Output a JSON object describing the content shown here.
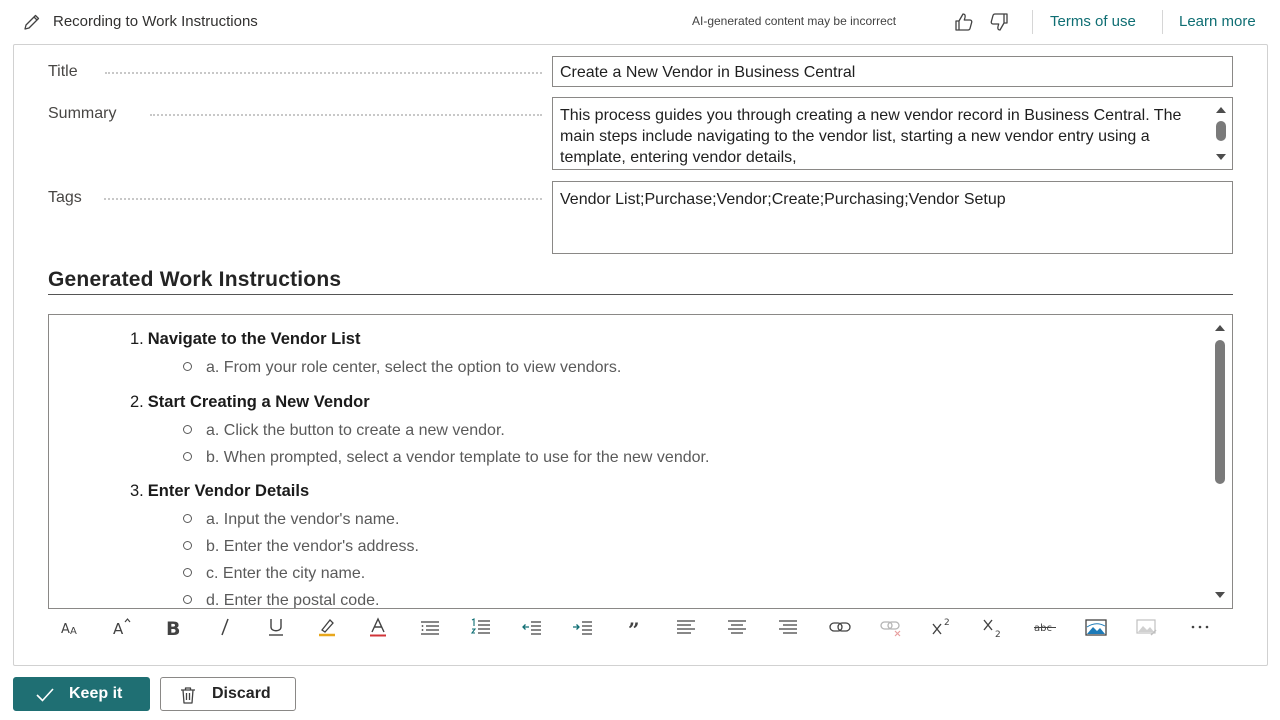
{
  "header": {
    "title": "Recording to Work Instructions",
    "disclaimer": "AI-generated content may be incorrect",
    "terms_link": "Terms of use",
    "learn_link": "Learn more"
  },
  "form": {
    "title_label": "Title",
    "title_value": "Create a New Vendor in Business Central",
    "summary_label": "Summary",
    "summary_value": "This process guides you through creating a new vendor record in Business Central. The main steps include navigating to the vendor list, starting a new vendor entry using a template, entering vendor details,",
    "tags_label": "Tags",
    "tags_value": "Vendor List;Purchase;Vendor;Create;Purchasing;Vendor Setup"
  },
  "section": {
    "title": "Generated Work Instructions"
  },
  "instructions": [
    {
      "num": "1.",
      "title": "Navigate to the Vendor List",
      "subs": [
        "a. From your role center, select the option to view vendors."
      ]
    },
    {
      "num": "2.",
      "title": "Start Creating a New Vendor",
      "subs": [
        "a. Click the button to create a new vendor.",
        "b. When prompted, select a vendor template to use for the new vendor."
      ]
    },
    {
      "num": "3.",
      "title": "Enter Vendor Details",
      "subs": [
        "a. Input the vendor's name.",
        "b. Enter the vendor's address.",
        "c. Enter the city name.",
        "d. Enter the postal code."
      ]
    }
  ],
  "toolbar_icons": [
    "font-size-icon",
    "font-grow-icon",
    "bold-icon",
    "italic-icon",
    "underline-icon",
    "highlight-icon",
    "font-color-icon",
    "bullet-list-icon",
    "numbered-list-icon",
    "outdent-icon",
    "indent-icon",
    "quote-icon",
    "align-left-icon",
    "align-center-icon",
    "align-right-icon",
    "link-icon",
    "unlink-icon",
    "superscript-icon",
    "subscript-icon",
    "strikethrough-icon",
    "insert-image-icon",
    "edit-image-icon",
    "more-options-icon"
  ],
  "buttons": {
    "keep": "Keep it",
    "discard": "Discard"
  },
  "colors": {
    "accent": "#1f6f73",
    "link": "#0f6e73"
  }
}
